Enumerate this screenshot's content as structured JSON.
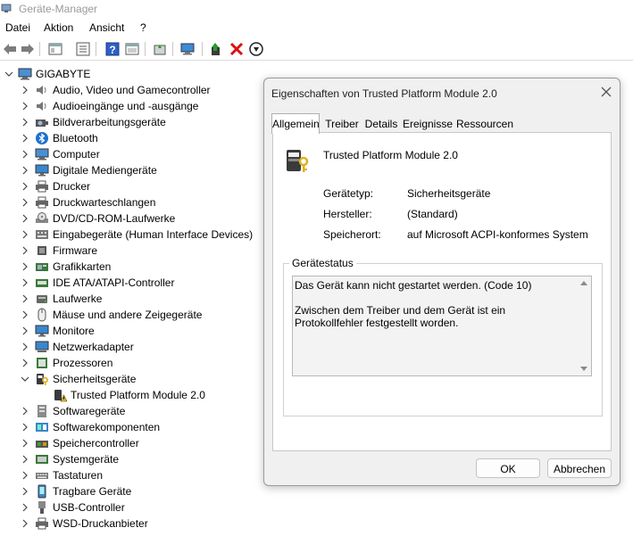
{
  "window": {
    "title": "Geräte-Manager"
  },
  "menu": [
    "Datei",
    "Aktion",
    "Ansicht",
    "?"
  ],
  "toolbar": [
    "back-icon",
    "forward-icon",
    "properties-pane-icon",
    "list-icon",
    "help-icon",
    "view-icon",
    "update-driver-icon",
    "monitor-icon",
    "add-driver-icon",
    "delete-icon",
    "install-icon"
  ],
  "tree": {
    "root": "GIGABYTE",
    "items": [
      {
        "label": "Audio, Video und Gamecontroller",
        "icon": "speaker-icon"
      },
      {
        "label": "Audioeingänge und -ausgänge",
        "icon": "speaker-icon"
      },
      {
        "label": "Bildverarbeitungsgeräte",
        "icon": "camera-icon"
      },
      {
        "label": "Bluetooth",
        "icon": "bluetooth-icon"
      },
      {
        "label": "Computer",
        "icon": "computer-icon"
      },
      {
        "label": "Digitale Mediengeräte",
        "icon": "monitor-icon"
      },
      {
        "label": "Drucker",
        "icon": "printer-icon"
      },
      {
        "label": "Druckwarteschlangen",
        "icon": "printer-icon"
      },
      {
        "label": "DVD/CD-ROM-Laufwerke",
        "icon": "disc-icon"
      },
      {
        "label": "Eingabegeräte (Human Interface Devices)",
        "icon": "hid-icon"
      },
      {
        "label": "Firmware",
        "icon": "chip-icon"
      },
      {
        "label": "Grafikkarten",
        "icon": "display-adapter-icon"
      },
      {
        "label": "IDE ATA/ATAPI-Controller",
        "icon": "controller-icon"
      },
      {
        "label": "Laufwerke",
        "icon": "drive-icon"
      },
      {
        "label": "Mäuse und andere Zeigegeräte",
        "icon": "mouse-icon"
      },
      {
        "label": "Monitore",
        "icon": "monitor-icon"
      },
      {
        "label": "Netzwerkadapter",
        "icon": "network-icon"
      },
      {
        "label": "Prozessoren",
        "icon": "cpu-icon"
      },
      {
        "label": "Sicherheitsgeräte",
        "icon": "security-icon",
        "expanded": true
      },
      {
        "label": "Trusted Platform Module 2.0",
        "icon": "warning-icon",
        "child": true
      },
      {
        "label": "Softwaregeräte",
        "icon": "software-icon"
      },
      {
        "label": "Softwarekomponenten",
        "icon": "puzzle-icon"
      },
      {
        "label": "Speichercontroller",
        "icon": "storage-icon"
      },
      {
        "label": "Systemgeräte",
        "icon": "system-icon"
      },
      {
        "label": "Tastaturen",
        "icon": "keyboard-icon"
      },
      {
        "label": "Tragbare Geräte",
        "icon": "portable-icon"
      },
      {
        "label": "USB-Controller",
        "icon": "usb-icon"
      },
      {
        "label": "WSD-Druckanbieter",
        "icon": "printer-icon"
      }
    ]
  },
  "dialog": {
    "title": "Eigenschaften von Trusted Platform Module 2.0",
    "tabs": [
      "Allgemein",
      "Treiber",
      "Details",
      "Ereignisse",
      "Ressourcen"
    ],
    "active_tab": "Allgemein",
    "device_name": "Trusted Platform Module 2.0",
    "props": [
      {
        "label": "Gerätetyp:",
        "value": "Sicherheitsgeräte"
      },
      {
        "label": "Hersteller:",
        "value": "(Standard)"
      },
      {
        "label": "Speicherort:",
        "value": "auf Microsoft ACPI-konformes System"
      }
    ],
    "status_group": "Gerätestatus",
    "status_text": "Das Gerät kann nicht gestartet werden. (Code 10)\n\nZwischen dem Treiber und dem Gerät ist ein Protokollfehler festgestellt worden.",
    "ok": "OK",
    "cancel": "Abbrechen"
  }
}
